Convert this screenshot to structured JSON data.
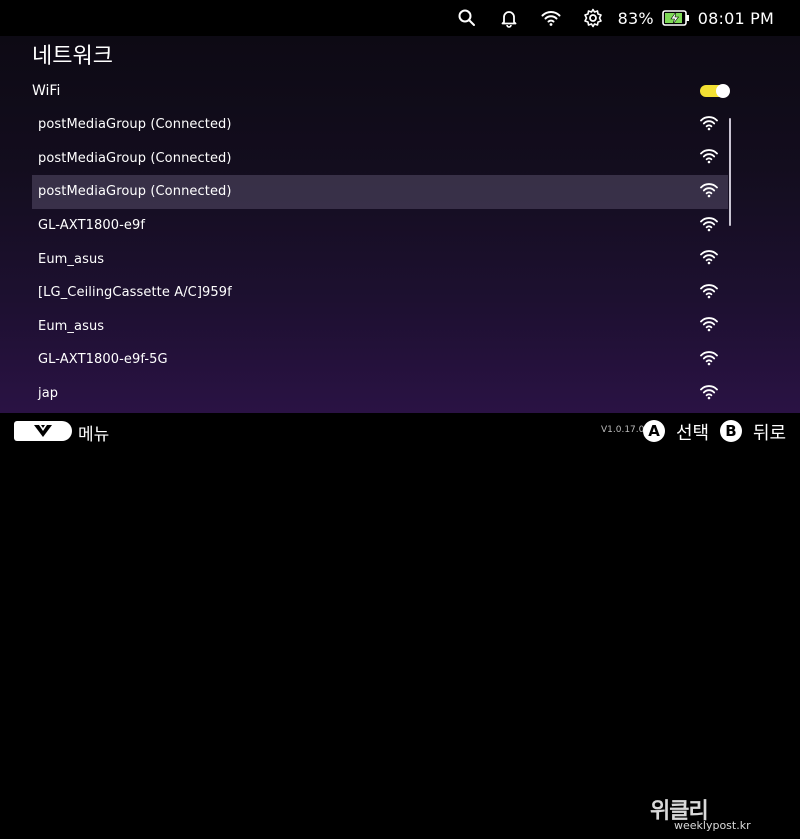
{
  "status_bar": {
    "battery_percent": "83%",
    "time": "08:01 PM",
    "icons": [
      "search-icon",
      "bell-icon",
      "wifi-icon",
      "gear-icon",
      "battery-charging-icon"
    ]
  },
  "page": {
    "title": "네트워크",
    "wifi_label": "WiFi",
    "wifi_enabled": true
  },
  "networks": [
    {
      "name": "postMediaGroup  (Connected)",
      "selected": false
    },
    {
      "name": "postMediaGroup  (Connected)",
      "selected": false
    },
    {
      "name": "postMediaGroup  (Connected)",
      "selected": true
    },
    {
      "name": "GL-AXT1800-e9f",
      "selected": false
    },
    {
      "name": "Eum_asus",
      "selected": false
    },
    {
      "name": "[LG_CeilingCassette A/C]959f",
      "selected": false
    },
    {
      "name": "Eum_asus",
      "selected": false
    },
    {
      "name": "GL-AXT1800-e9f-5G",
      "selected": false
    },
    {
      "name": "jap",
      "selected": false
    }
  ],
  "bottom_bar": {
    "menu_label": "메뉴",
    "version": "V1.0.17.0",
    "a_button": "A",
    "a_label": "선택",
    "b_button": "B",
    "b_label": "뒤로"
  },
  "watermark": {
    "logo": "위클리",
    "url": "weeklypost.kr"
  },
  "colors": {
    "toggle_on": "#f3e033",
    "battery_fill": "#7ed957"
  }
}
